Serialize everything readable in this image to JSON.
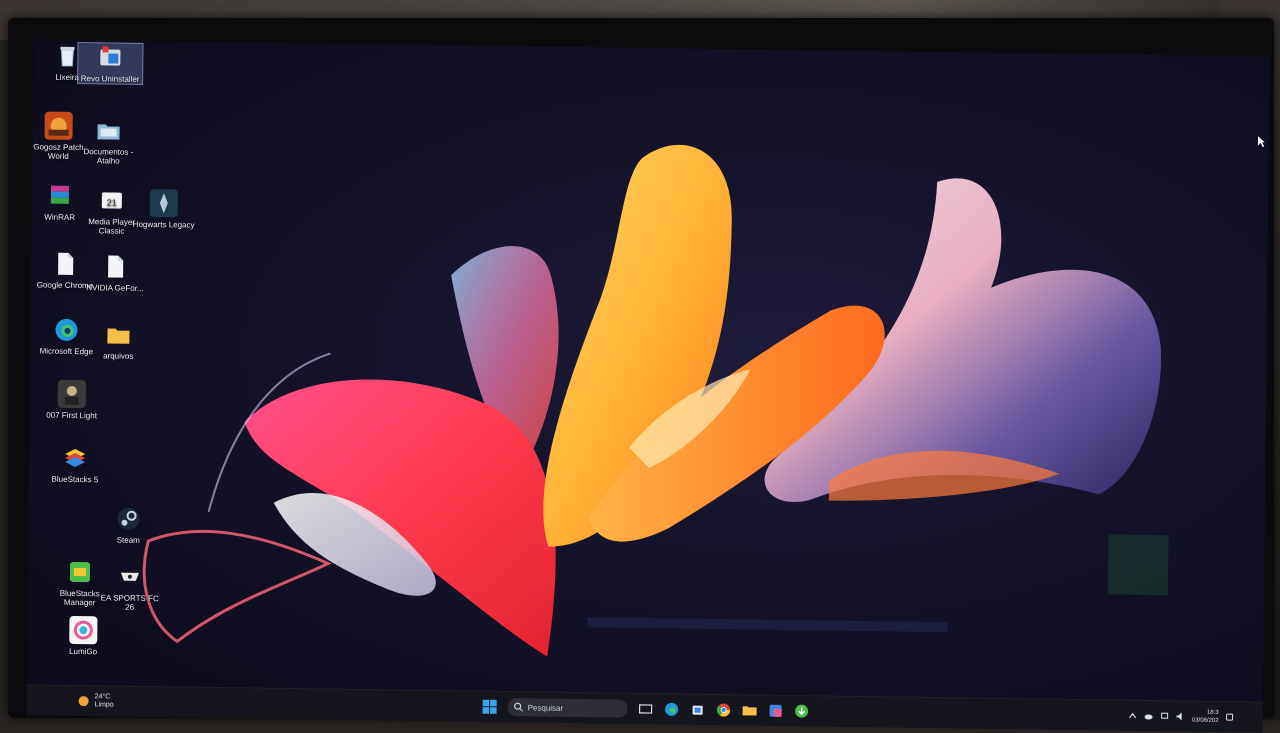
{
  "desktop": {
    "icons": [
      {
        "label": "Lixeira"
      },
      {
        "label": "Revo Uninstaller"
      },
      {
        "label": "Gogosz Patch World"
      },
      {
        "label": "Documentos - Atalho"
      },
      {
        "label": "WinRAR"
      },
      {
        "label": "Media Player Classic"
      },
      {
        "label": "Hogwarts Legacy"
      },
      {
        "label": "Google Chrome"
      },
      {
        "label": "NVIDIA GeFor..."
      },
      {
        "label": "Microsoft Edge"
      },
      {
        "label": "arquivos"
      },
      {
        "label": "007 First Light"
      },
      {
        "label": "BlueStacks 5"
      },
      {
        "label": "Steam"
      },
      {
        "label": "BlueStacks Manager"
      },
      {
        "label": "EA SPORTS FC 26"
      },
      {
        "label": "LumiGo"
      }
    ]
  },
  "taskbar": {
    "weather": {
      "temp": "24°C",
      "condition": "Limpo"
    },
    "search_placeholder": "Pesquisar",
    "clock": {
      "time": "18:3",
      "date": "03/08/202"
    }
  },
  "colors": {
    "accent": "#0078d4",
    "taskbar_bg": "#16161e"
  }
}
